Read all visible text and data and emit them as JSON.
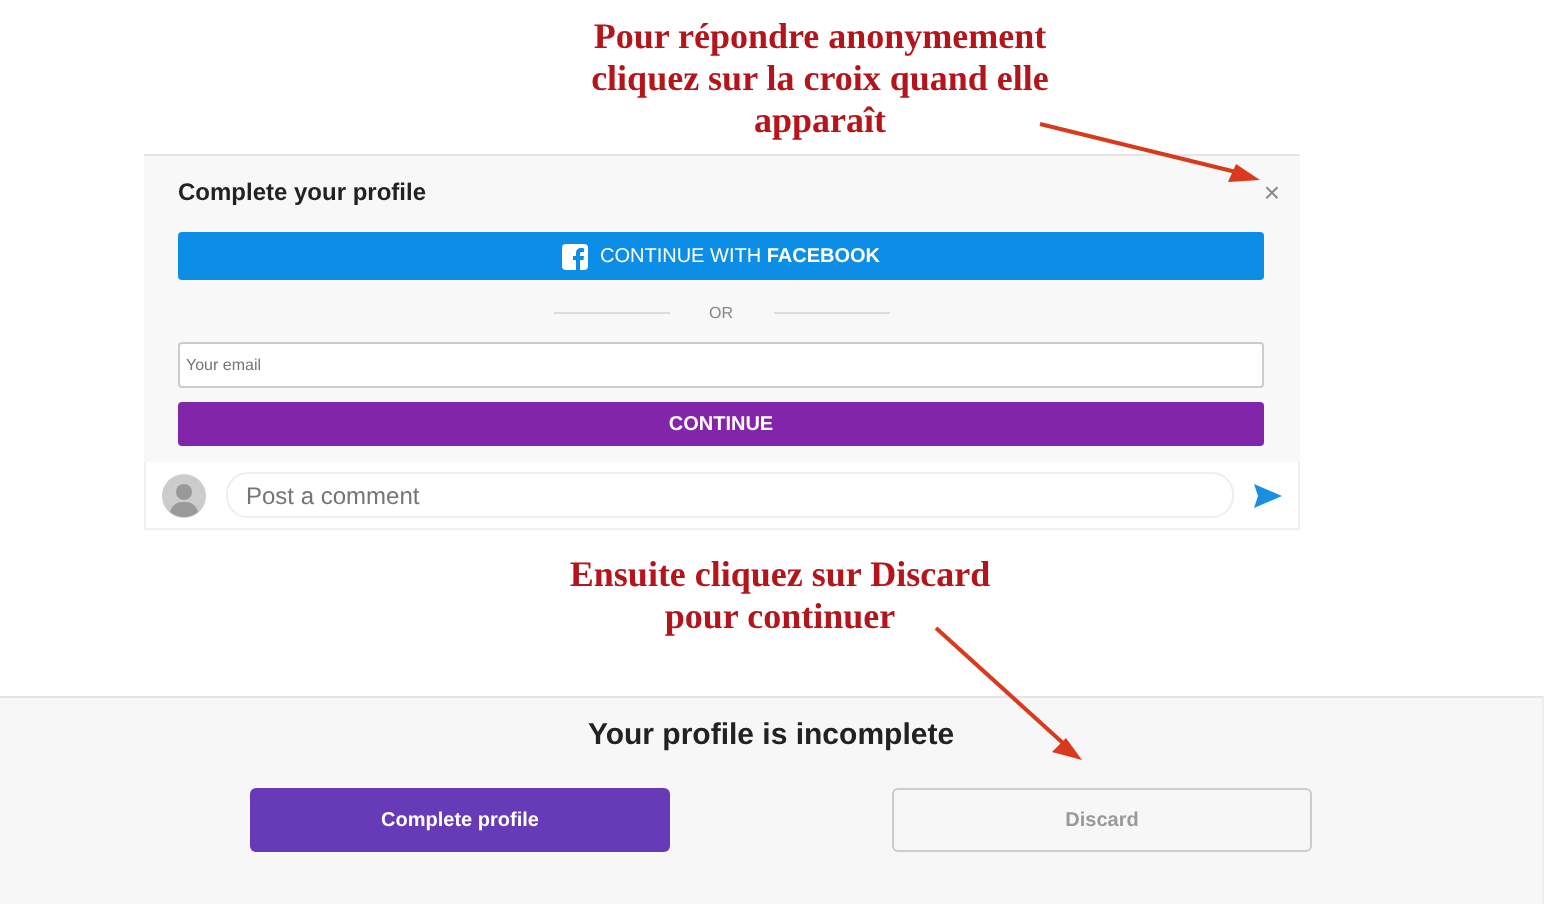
{
  "annotations": [
    {
      "lines": [
        "Pour répondre anonymement",
        "cliquez sur la croix quand elle",
        "apparaît"
      ]
    },
    {
      "lines": [
        "Ensuite cliquez sur Discard",
        "pour continuer"
      ]
    }
  ],
  "signup_card": {
    "title": "Complete your profile",
    "close": "×",
    "facebook_button": "CONTINUE WITH **FACEBOOK**",
    "separator": "OR",
    "email": {
      "placeholder": "Your email"
    },
    "continue_button": "CONTINUE"
  },
  "comment_box": {
    "placeholder": "Post a comment"
  },
  "prompt": {
    "title": "Your profile is incomplete",
    "buttons": [
      {
        "label": "Complete profile",
        "kind": "primary"
      },
      {
        "label": "Discard",
        "kind": "secondary"
      }
    ]
  }
}
